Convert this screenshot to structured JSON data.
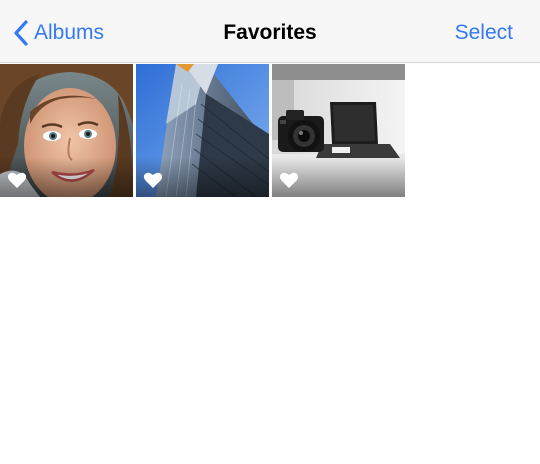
{
  "navbar": {
    "back_label": "Albums",
    "title": "Favorites",
    "select_label": "Select"
  },
  "photos": [
    {
      "subject": "portrait",
      "favorite": true
    },
    {
      "subject": "building",
      "favorite": true
    },
    {
      "subject": "camera-desk",
      "favorite": true
    }
  ],
  "colors": {
    "accent": "#3478f6",
    "navbar_bg": "#f7f7f7"
  }
}
